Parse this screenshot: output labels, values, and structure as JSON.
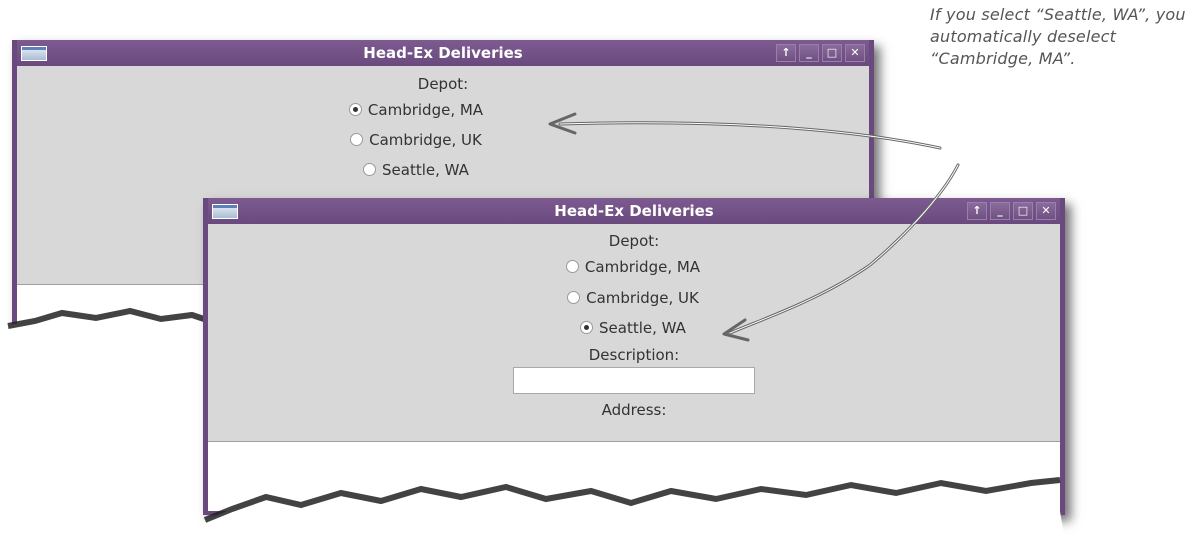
{
  "window_back": {
    "title": "Head-Ex Deliveries",
    "controls": [
      "↑",
      "_",
      "□",
      "✕"
    ],
    "depot_label": "Depot:",
    "options": [
      {
        "label": "Cambridge, MA",
        "checked": true
      },
      {
        "label": "Cambridge, UK",
        "checked": false
      },
      {
        "label": "Seattle, WA",
        "checked": false
      }
    ]
  },
  "window_front": {
    "title": "Head-Ex Deliveries",
    "controls": [
      "↑",
      "_",
      "□",
      "✕"
    ],
    "depot_label": "Depot:",
    "options": [
      {
        "label": "Cambridge, MA",
        "checked": false
      },
      {
        "label": "Cambridge, UK",
        "checked": false
      },
      {
        "label": "Seattle, WA",
        "checked": true
      }
    ],
    "description_label": "Description:",
    "description_value": "",
    "address_label": "Address:"
  },
  "annotation": {
    "text": "If you select “Seattle, WA”, you automatically deselect “Cambridge, MA”."
  },
  "colors": {
    "frame": "#6a4a7e",
    "window_bg": "#d8d8d8",
    "text": "#333333"
  }
}
